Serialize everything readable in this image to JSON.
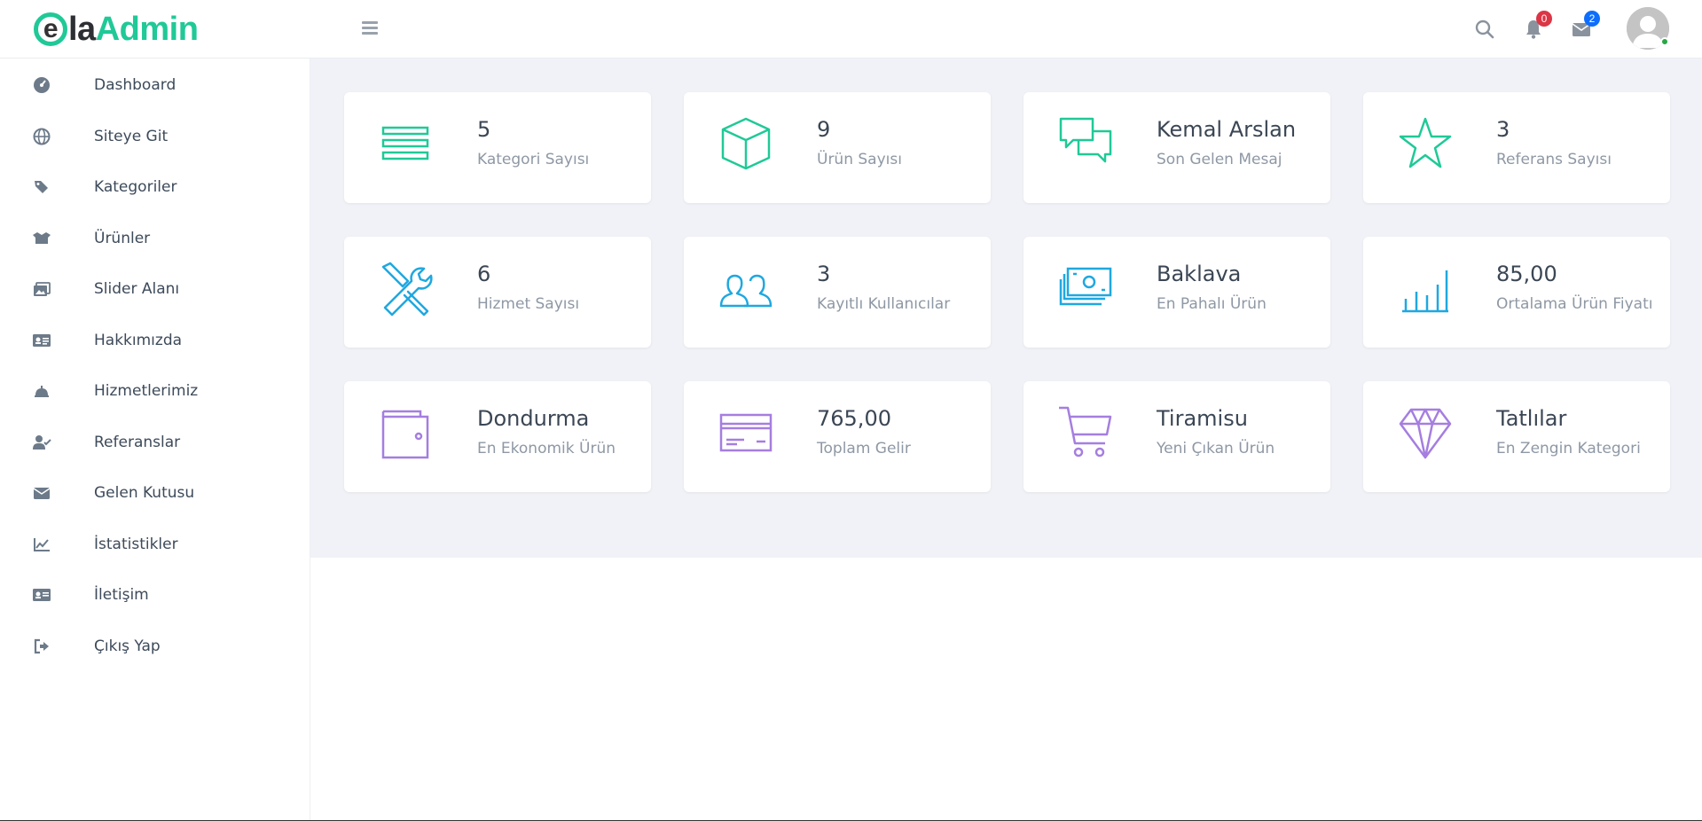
{
  "header": {
    "logo": {
      "e": "e",
      "la": "la",
      "admin": "Admin"
    },
    "notifications_count": "0",
    "messages_count": "2"
  },
  "sidebar": {
    "items": [
      {
        "label": "Dashboard",
        "icon": "dashboard-icon"
      },
      {
        "label": "Siteye Git",
        "icon": "globe-icon"
      },
      {
        "label": "Kategoriler",
        "icon": "tags-icon"
      },
      {
        "label": "Ürünler",
        "icon": "box-open-icon"
      },
      {
        "label": "Slider Alanı",
        "icon": "images-icon"
      },
      {
        "label": "Hakkımızda",
        "icon": "id-card-icon"
      },
      {
        "label": "Hizmetlerimiz",
        "icon": "concierge-bell-icon"
      },
      {
        "label": "Referanslar",
        "icon": "user-check-icon"
      },
      {
        "label": "Gelen Kutusu",
        "icon": "envelope-icon"
      },
      {
        "label": "İstatistikler",
        "icon": "line-chart-icon"
      },
      {
        "label": "İletişim",
        "icon": "address-card-icon"
      },
      {
        "label": "Çıkış Yap",
        "icon": "sign-out-icon"
      }
    ]
  },
  "cards": [
    {
      "value": "5",
      "caption": "Kategori Sayısı",
      "icon": "list-icon",
      "color": "#20c997"
    },
    {
      "value": "9",
      "caption": "Ürün Sayısı",
      "icon": "cube-icon",
      "color": "#20c997"
    },
    {
      "value": "Kemal Arslan",
      "caption": "Son Gelen Mesaj",
      "icon": "comments-icon",
      "color": "#20c997"
    },
    {
      "value": "3",
      "caption": "Referans Sayısı",
      "icon": "star-icon",
      "color": "#20c997"
    },
    {
      "value": "6",
      "caption": "Hizmet Sayısı",
      "icon": "tools-icon",
      "color": "#1fa8e0"
    },
    {
      "value": "3",
      "caption": "Kayıtlı Kullanıcılar",
      "icon": "users-icon",
      "color": "#1fa8e0"
    },
    {
      "value": "Baklava",
      "caption": "En Pahalı Ürün",
      "icon": "money-icon",
      "color": "#1fa8e0"
    },
    {
      "value": "85,00",
      "caption": "Ortalama Ürün Fiyatı",
      "icon": "bar-chart-icon",
      "color": "#1fa8e0"
    },
    {
      "value": "Dondurma",
      "caption": "En Ekonomik Ürün",
      "icon": "wallet-icon",
      "color": "#a57ee0"
    },
    {
      "value": "765,00",
      "caption": "Toplam Gelir",
      "icon": "credit-card-icon",
      "color": "#a57ee0"
    },
    {
      "value": "Tiramisu",
      "caption": "Yeni Çıkan Ürün",
      "icon": "cart-icon",
      "color": "#a57ee0"
    },
    {
      "value": "Tatlılar",
      "caption": "En Zengin Kategori",
      "icon": "diamond-icon",
      "color": "#a57ee0"
    }
  ]
}
